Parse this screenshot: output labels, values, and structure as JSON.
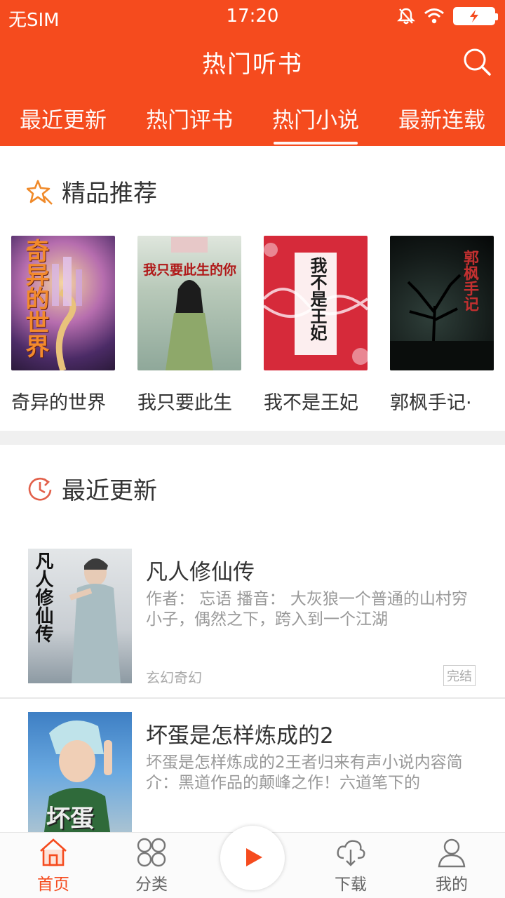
{
  "status_bar": {
    "carrier": "无SIM",
    "time": "17:20"
  },
  "header": {
    "title": "热门听书"
  },
  "tabs": [
    {
      "label": "最近更新"
    },
    {
      "label": "热门评书"
    },
    {
      "label": "热门小说",
      "active": true
    },
    {
      "label": "最新连载"
    }
  ],
  "featured": {
    "title": "精品推荐",
    "books": [
      {
        "name": "奇异的世界",
        "cover_text": "奇异的世界"
      },
      {
        "name": "我只要此生",
        "cover_text": "我只要此生的你"
      },
      {
        "name": "我不是王妃",
        "cover_text": "我不是王妃"
      },
      {
        "name": "郭枫手记·",
        "cover_text": "郭枫手记"
      }
    ]
  },
  "recent": {
    "title": "最近更新",
    "items": [
      {
        "title": "凡人修仙传",
        "desc": "作者： 忘语 播音： 大灰狼一个普通的山村穷小子，偶然之下，跨入到一个江湖",
        "tag": "玄幻奇幻",
        "status": "完结",
        "cover_text": "凡人修仙传"
      },
      {
        "title": "坏蛋是怎样炼成的2",
        "desc": "坏蛋是怎样炼成的2王者归来有声小说内容简介：黑道作品的颠峰之作！六道笔下的",
        "cover_text": "坏蛋"
      }
    ]
  },
  "bottom_nav": [
    {
      "label": "首页",
      "active": true
    },
    {
      "label": "分类"
    },
    {
      "label": "下载"
    },
    {
      "label": "我的"
    }
  ],
  "colors": {
    "accent": "#f54b1e"
  }
}
